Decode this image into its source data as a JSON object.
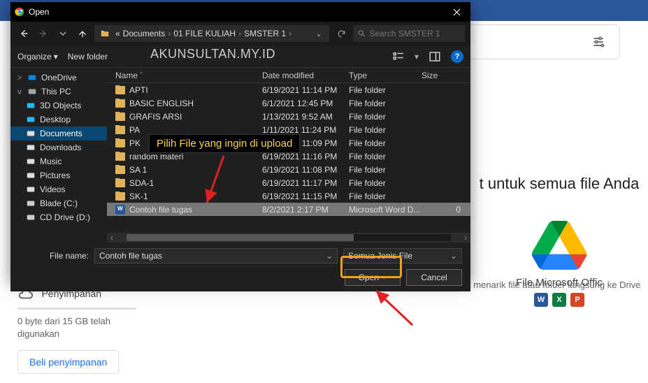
{
  "drive": {
    "headline": "t untuk semua file Anda",
    "filetype_caption": "File Microsoft Offic",
    "hint": "t menarik file atau folder langsung ke Drive",
    "storage_label": "Penyimpanan",
    "storage_usage": "0 byte dari 15 GB telah digunakan",
    "buy_label": "Beli penyimpanan"
  },
  "watermark": "AKUNSULTAN.MY.ID",
  "callout_text": "Pilih File yang ingin di upload",
  "dialog": {
    "title": "Open",
    "breadcrumb": {
      "segments": [
        "Documents",
        "01 FILE KULIAH",
        "SMSTER 1"
      ],
      "prefix": "«"
    },
    "search_placeholder": "Search SMSTER 1",
    "toolbar": {
      "organize": "Organize",
      "new_folder": "New folder"
    },
    "columns": {
      "name": "Name",
      "date": "Date modified",
      "type": "Type",
      "size": "Size"
    },
    "filename_label": "File name:",
    "filename_value": "Contoh file tugas",
    "filetype_value": "Semua Jenis File",
    "open_btn": "Open",
    "cancel_btn": "Cancel"
  },
  "sidebar": [
    {
      "label": "OneDrive",
      "icon": "onedrive",
      "level": 1,
      "tree": ">"
    },
    {
      "label": "This PC",
      "icon": "pc",
      "level": 1,
      "tree": "v"
    },
    {
      "label": "3D Objects",
      "icon": "3d",
      "level": 2
    },
    {
      "label": "Desktop",
      "icon": "desktop",
      "level": 2
    },
    {
      "label": "Documents",
      "icon": "docs",
      "level": 2,
      "selected": true
    },
    {
      "label": "Downloads",
      "icon": "dl",
      "level": 2
    },
    {
      "label": "Music",
      "icon": "music",
      "level": 2
    },
    {
      "label": "Pictures",
      "icon": "pics",
      "level": 2
    },
    {
      "label": "Videos",
      "icon": "vids",
      "level": 2
    },
    {
      "label": "Blade (C:)",
      "icon": "disk",
      "level": 2,
      "tree": ">"
    },
    {
      "label": "CD Drive (D:)",
      "icon": "cd",
      "level": 2
    }
  ],
  "files": [
    {
      "name": "APTI",
      "date": "6/19/2021 11:14 PM",
      "type": "File folder",
      "size": "",
      "kind": "folder"
    },
    {
      "name": "BASIC ENGLISH",
      "date": "6/1/2021 12:45 PM",
      "type": "File folder",
      "size": "",
      "kind": "folder"
    },
    {
      "name": "GRAFIS ARSI",
      "date": "1/13/2021 9:52 AM",
      "type": "File folder",
      "size": "",
      "kind": "folder"
    },
    {
      "name": "PA",
      "date": "1/11/2021 11:24 PM",
      "type": "File folder",
      "size": "",
      "kind": "folder"
    },
    {
      "name": "PK",
      "date": "6/19/2021 11:09 PM",
      "type": "File folder",
      "size": "",
      "kind": "folder"
    },
    {
      "name": "random materi",
      "date": "6/19/2021 11:16 PM",
      "type": "File folder",
      "size": "",
      "kind": "folder"
    },
    {
      "name": "SA 1",
      "date": "6/19/2021 11:08 PM",
      "type": "File folder",
      "size": "",
      "kind": "folder"
    },
    {
      "name": "SDA-1",
      "date": "6/19/2021 11:17 PM",
      "type": "File folder",
      "size": "",
      "kind": "folder"
    },
    {
      "name": "SK-1",
      "date": "6/19/2021 11:15 PM",
      "type": "File folder",
      "size": "",
      "kind": "folder"
    },
    {
      "name": "Contoh file tugas",
      "date": "8/2/2021 2:17 PM",
      "type": "Microsoft Word D...",
      "size": "0",
      "kind": "doc",
      "selected": true
    }
  ]
}
